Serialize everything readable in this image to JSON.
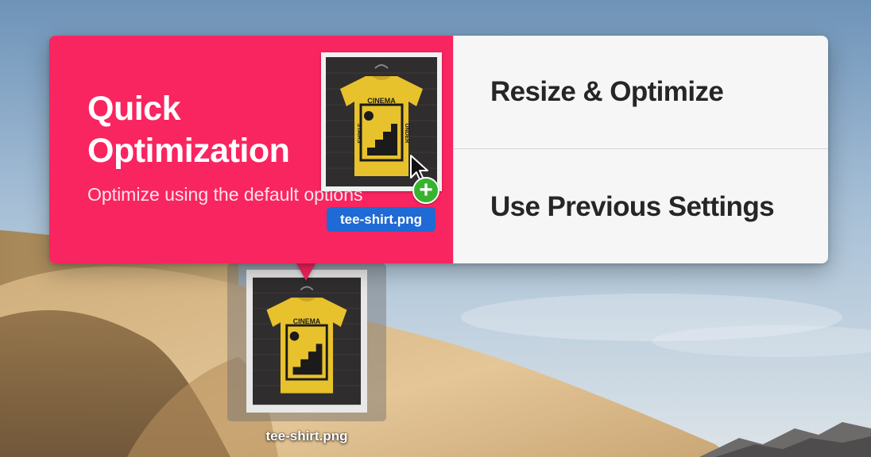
{
  "quick_optimization": {
    "title": "Quick Optimization",
    "subtitle": "Optimize using the default options"
  },
  "options": {
    "resize_optimize": "Resize & Optimize",
    "use_previous": "Use Previous Settings"
  },
  "drag_item": {
    "file_name": "tee-shirt.png",
    "badge": "+"
  },
  "desktop_file": {
    "file_name": "tee-shirt.png"
  },
  "shirt_print": {
    "top_text": "CINEMA",
    "left_text": "STAIRS",
    "right_text": "UNDER"
  },
  "colors": {
    "accent_pink": "#f82560",
    "panel_bg": "#f6f6f6",
    "drag_label_blue": "#1f6ad4",
    "add_badge_green": "#38b32f",
    "shirt_yellow": "#e8c22c"
  },
  "icons": {
    "cursor": "arrow-cursor-icon",
    "add": "plus-circle-icon"
  }
}
